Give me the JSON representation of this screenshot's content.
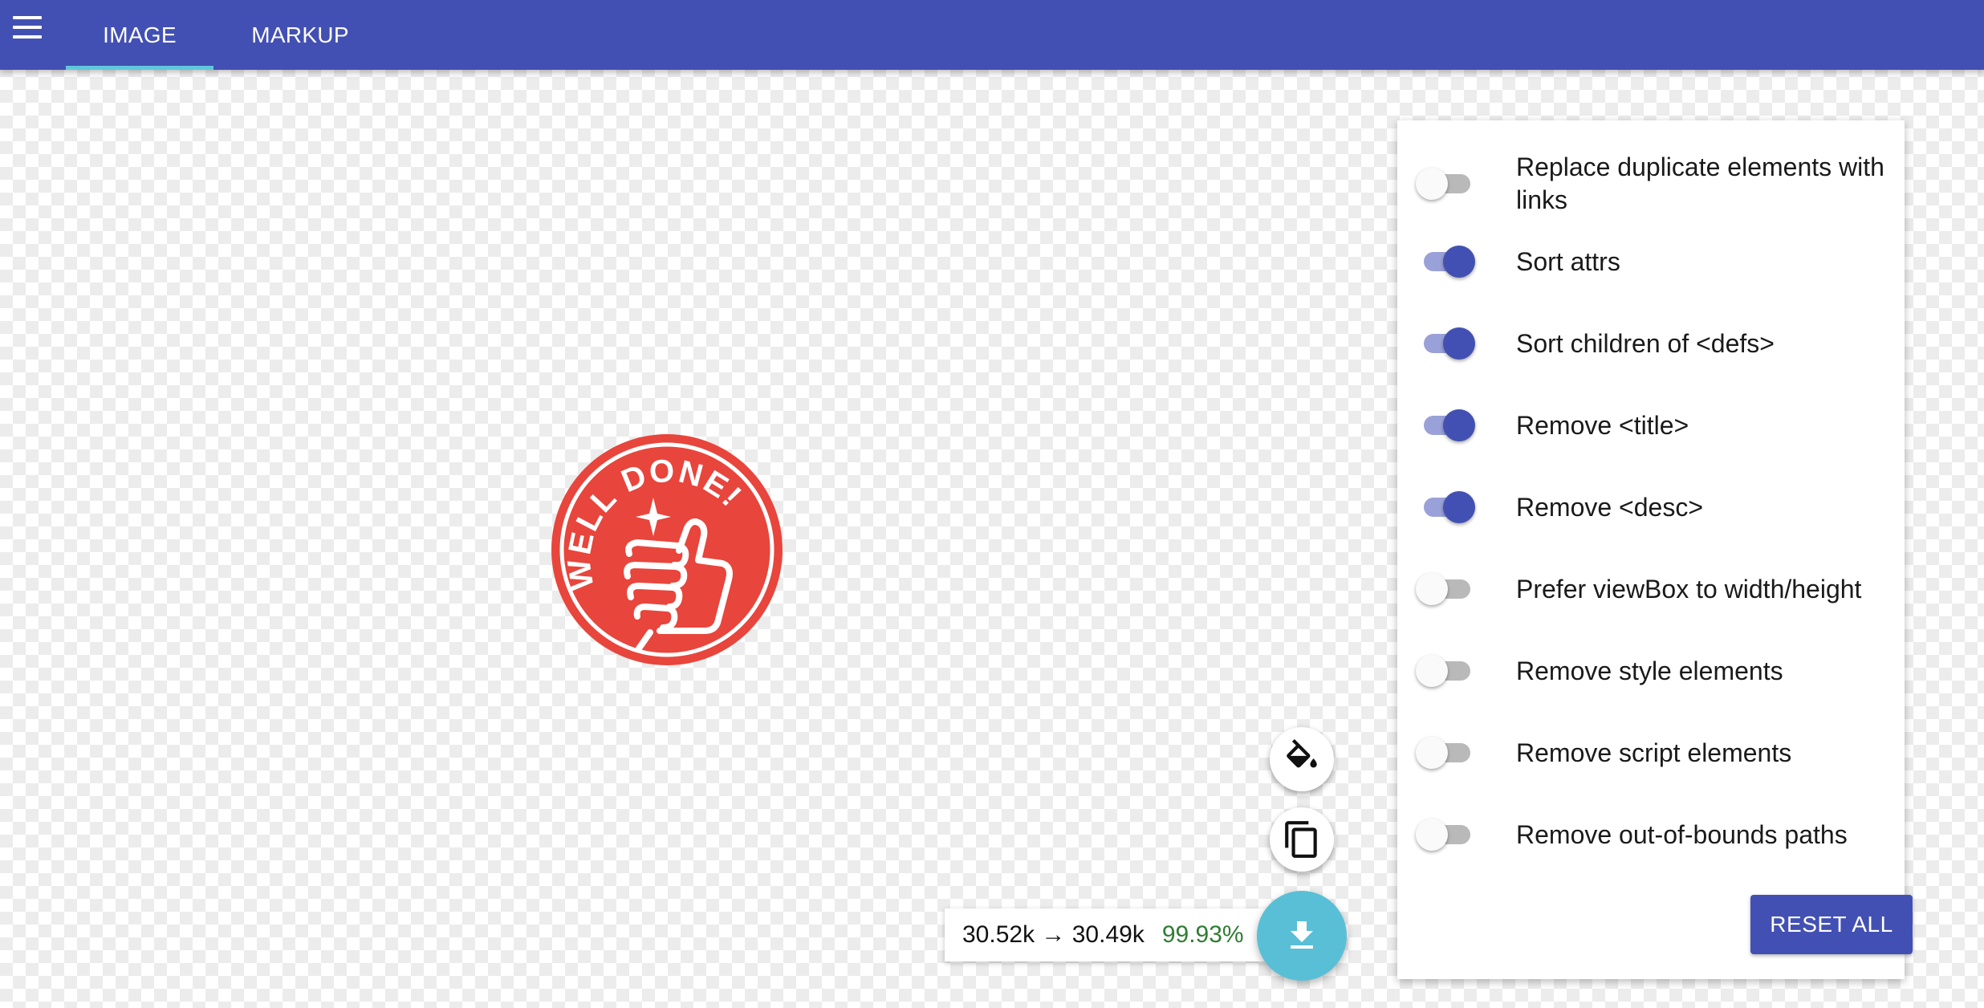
{
  "header": {
    "tabs": [
      {
        "label": "IMAGE",
        "active": true
      },
      {
        "label": "MARKUP",
        "active": false
      }
    ]
  },
  "artwork": {
    "stamp_text": "WELL DONE!",
    "color": "#e8453c"
  },
  "settings": {
    "options": [
      {
        "label": "Replace duplicate elements with links",
        "enabled": false
      },
      {
        "label": "Sort attrs",
        "enabled": true
      },
      {
        "label": "Sort children of <defs>",
        "enabled": true
      },
      {
        "label": "Remove <title>",
        "enabled": true
      },
      {
        "label": "Remove <desc>",
        "enabled": true
      },
      {
        "label": "Prefer viewBox to width/height",
        "enabled": false
      },
      {
        "label": "Remove style elements",
        "enabled": false
      },
      {
        "label": "Remove script elements",
        "enabled": false
      },
      {
        "label": "Remove out-of-bounds paths",
        "enabled": false
      }
    ],
    "reset_label": "RESET ALL"
  },
  "results": {
    "sizes": "30.52k → 30.49k",
    "percent": "99.93%"
  },
  "colors": {
    "primary": "#4350b3",
    "accent": "#59bfd6",
    "success": "#2e7d32"
  },
  "icons": {
    "menu": "menu-icon",
    "background": "paint-bucket-icon",
    "copy": "copy-icon",
    "download": "download-icon"
  }
}
